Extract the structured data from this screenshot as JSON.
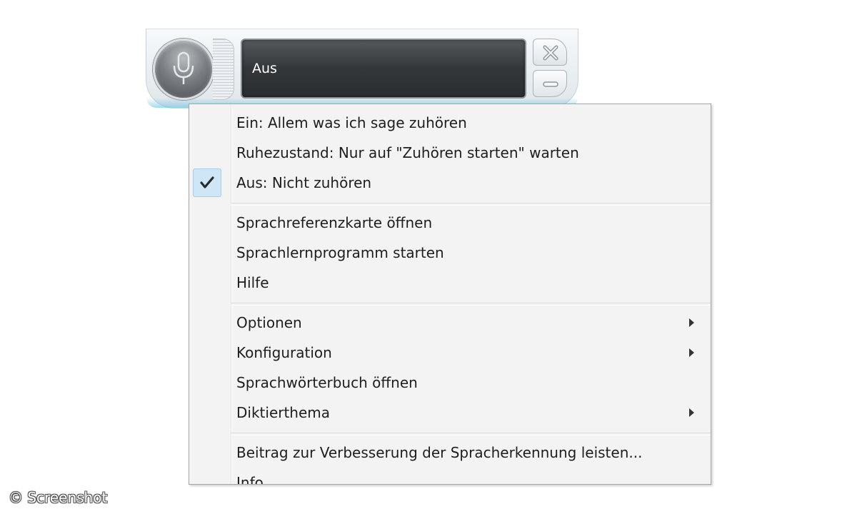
{
  "speech_bar": {
    "status": "Aus",
    "mic_icon": "microphone-icon",
    "close_icon": "close-icon",
    "minimize_icon": "minimize-icon"
  },
  "menu": {
    "items": [
      {
        "label": "Ein: Allem was ich sage zuhören",
        "checked": false,
        "submenu": false
      },
      {
        "label": "Ruhezustand: Nur auf \"Zuhören starten\" warten",
        "checked": false,
        "submenu": false
      },
      {
        "label": "Aus: Nicht zuhören",
        "checked": true,
        "submenu": false
      },
      {
        "label": "Sprachreferenzkarte öffnen",
        "checked": false,
        "submenu": false
      },
      {
        "label": "Sprachlernprogramm starten",
        "checked": false,
        "submenu": false
      },
      {
        "label": "Hilfe",
        "checked": false,
        "submenu": false
      },
      {
        "label": "Optionen",
        "checked": false,
        "submenu": true
      },
      {
        "label": "Konfiguration",
        "checked": false,
        "submenu": true
      },
      {
        "label": "Sprachwörterbuch öffnen",
        "checked": false,
        "submenu": false
      },
      {
        "label": "Diktierthema",
        "checked": false,
        "submenu": true
      },
      {
        "label": "Beitrag zur Verbesserung der Spracherkennung leisten...",
        "checked": false,
        "submenu": false
      },
      {
        "label": "Info",
        "checked": false,
        "submenu": false
      }
    ],
    "check_icon": "checkmark-icon",
    "submenu_icon": "submenu-arrow-icon"
  },
  "watermark": "© Screenshot",
  "colors": {
    "menu_background": "#f3f3f3",
    "checked_highlight": "#cfe6f6",
    "status_display": "#34373a"
  }
}
